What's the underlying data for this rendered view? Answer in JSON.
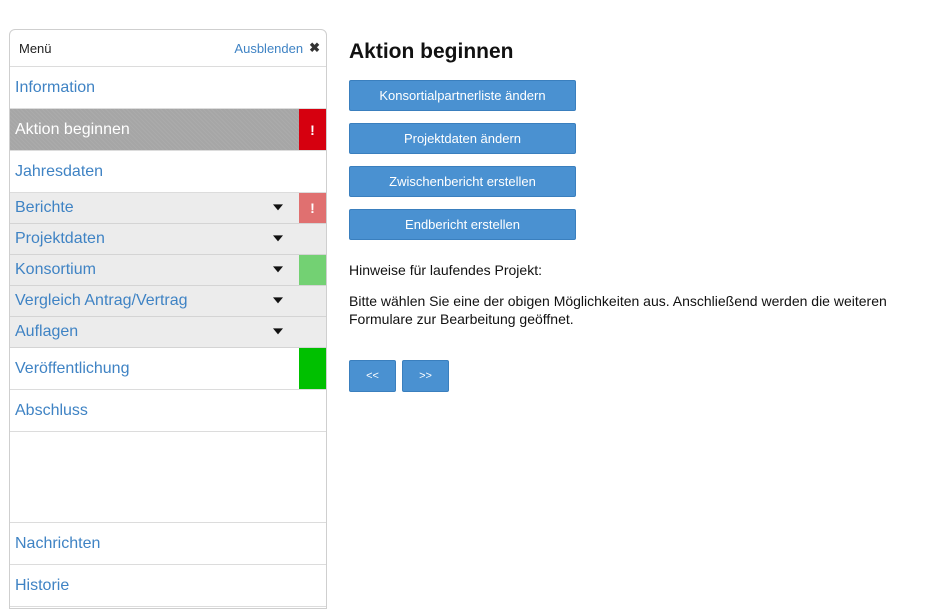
{
  "sidebar": {
    "menu_title": "Menü",
    "hide_label": "Ausblenden",
    "hide_icon": "close-icon",
    "items": {
      "information": "Information",
      "aktion_beginnen": "Aktion beginnen",
      "jahresdaten": "Jahresdaten",
      "berichte": "Berichte",
      "projektdaten": "Projektdaten",
      "konsortium": "Konsortium",
      "vergleich": "Vergleich Antrag/Vertrag",
      "auflagen": "Auflagen",
      "veroeffentlichung": "Veröffentlichung",
      "abschluss": "Abschluss",
      "nachrichten": "Nachrichten",
      "historie": "Historie"
    },
    "status_mark": "!",
    "status_colors": {
      "red": "#d6000f",
      "light_red": "#e07070",
      "light_green": "#73d173",
      "green": "#00c000"
    }
  },
  "main": {
    "title": "Aktion beginnen",
    "buttons": {
      "konsortial": "Konsortialpartnerliste ändern",
      "projektdaten": "Projektdaten ändern",
      "zwischenbericht": "Zwischenbericht erstellen",
      "endbericht": "Endbericht erstellen"
    },
    "hint_title": "Hinweise für laufendes Projekt:",
    "hint_text": "Bitte wählen Sie eine der obigen Möglichkeiten aus. Anschließend werden die weiteren Formulare zur Bearbeitung geöffnet.",
    "nav": {
      "prev": "<<",
      "next": ">>"
    }
  },
  "colors": {
    "accent": "#4a91d1",
    "link": "#3f83c4",
    "active_bg": "#a6a6a6"
  }
}
